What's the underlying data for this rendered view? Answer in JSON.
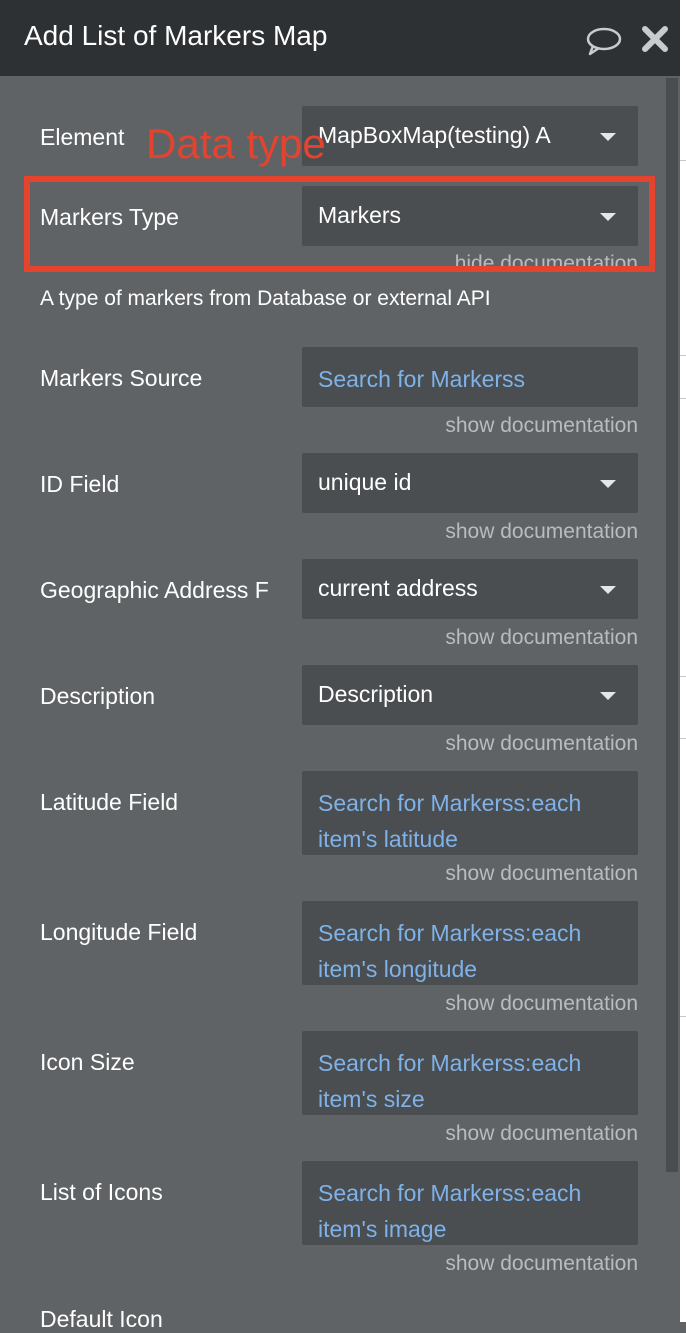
{
  "header": {
    "title": "Add List of Markers Map",
    "chat_icon": "chat-bubble-icon",
    "close_icon": "close-icon"
  },
  "annotation": {
    "text": "Data type",
    "color": "#e4432e"
  },
  "fields": {
    "element": {
      "label": "Element",
      "value": "MapBoxMap(testing) A"
    },
    "markers_type": {
      "label": "Markers Type",
      "value": "Markers",
      "doc": "hide documentation",
      "description": "A type of markers from Database or external API"
    },
    "markers_source": {
      "label": "Markers Source",
      "value": "Search for Markerss",
      "doc": "show documentation"
    },
    "id_field": {
      "label": "ID Field",
      "value": "unique id",
      "doc": "show documentation"
    },
    "geo_address": {
      "label": "Geographic Address F",
      "value": "current address",
      "doc": "show documentation"
    },
    "description": {
      "label": "Description",
      "value": "Description",
      "doc": "show documentation"
    },
    "latitude": {
      "label": "Latitude Field",
      "value": "Search for Markerss:each item's latitude",
      "doc": "show documentation"
    },
    "longitude": {
      "label": "Longitude Field",
      "value": "Search for Markerss:each item's longitude",
      "doc": "show documentation"
    },
    "icon_size": {
      "label": "Icon Size",
      "value": "Search for Markerss:each item's size",
      "doc": "show documentation"
    },
    "list_of_icons": {
      "label": "List of Icons",
      "value": "Search for Markerss:each item's image",
      "doc": "show documentation"
    },
    "default_icon": {
      "label": "Default Icon"
    }
  },
  "colors": {
    "panel_bg": "#5f6366",
    "header_bg": "#2d3133",
    "field_bg": "#4a4e51",
    "link": "#7fb2e8",
    "muted": "#b9bcbe"
  }
}
